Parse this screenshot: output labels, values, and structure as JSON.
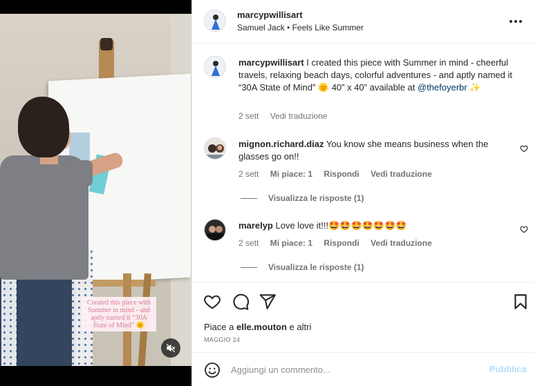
{
  "post": {
    "username": "marcypwillisart",
    "audio": "Samuel Jack • Feels Like Summer",
    "caption": {
      "username": "marcypwillisart",
      "text": "I created this piece with Summer in mind - cheerful travels, relaxing beach days, colorful adventures - and aptly named it “30A State of Mind” 🌞 40” x 40” available at",
      "mention": "@thefoyerbr",
      "trailing": "✨",
      "time": "2 sett",
      "translate": "Vedi traduzione"
    },
    "video_overlay_text": "Created this piece with Summer in mind - and aptly named it “30A State of Mind” 🌞"
  },
  "comments": [
    {
      "username": "mignon.richard.diaz",
      "text": "You know she means business when the glasses go on!!",
      "time": "2 sett",
      "likes": "Mi piace: 1",
      "reply": "Rispondi",
      "translate": "Vedi traduzione",
      "view_replies": "Visualizza le risposte (1)"
    },
    {
      "username": "marelyp",
      "text": "Love love it!!!🤩🤩🤩🤩🤩🤩🤩",
      "time": "2 sett",
      "likes": "Mi piace: 1",
      "reply": "Rispondi",
      "translate": "Vedi traduzione",
      "view_replies": "Visualizza le risposte (1)"
    }
  ],
  "footer": {
    "likes_prefix": "Piace a ",
    "likes_user": "elle.mouton",
    "likes_suffix": " e altri",
    "date": "MAGGIO 24",
    "comment_placeholder": "Aggiungi un commento...",
    "post_label": "Pubblica"
  },
  "icons": {
    "like": "heart-icon",
    "comment": "comment-icon",
    "share": "send-icon",
    "save": "bookmark-icon",
    "emoji": "emoji-icon",
    "more": "more-icon",
    "mute": "mute-icon"
  },
  "colors": {
    "link": "#00376b",
    "post_button": "#b2dffc",
    "secondary_text": "#737373"
  }
}
